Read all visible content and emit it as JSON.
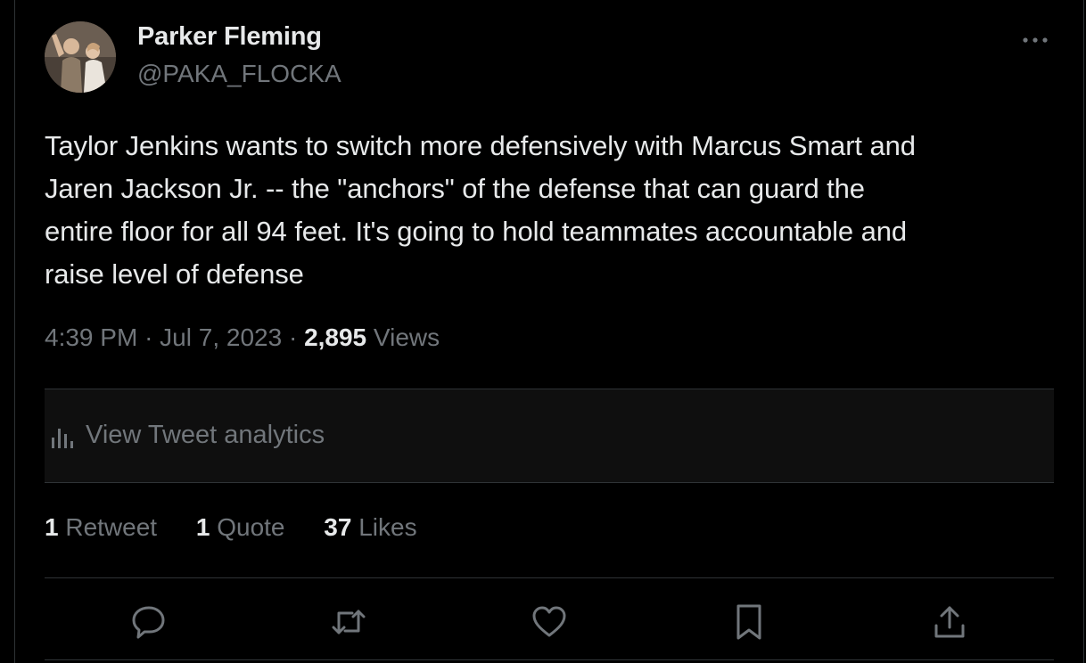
{
  "author": {
    "display_name": "Parker Fleming",
    "handle": "@PAKA_FLOCKA",
    "avatar_icon": "avatar-photo"
  },
  "tweet": {
    "text": "Taylor Jenkins wants to switch more defensively with Marcus Smart and\nJaren Jackson Jr. -- the \"anchors\" of the defense that can guard the\nentire floor for all 94 feet. It's going to hold teammates accountable and\nraise level of defense",
    "time": "4:39 PM",
    "separator": "·",
    "date": "Jul 7, 2023",
    "views_count": "2,895",
    "views_label": "Views"
  },
  "analytics": {
    "label": "View Tweet analytics",
    "icon": "analytics-icon"
  },
  "stats": {
    "retweets_count": "1",
    "retweets_label": "Retweet",
    "quotes_count": "1",
    "quotes_label": "Quote",
    "likes_count": "37",
    "likes_label": "Likes"
  },
  "actions": [
    "reply-icon",
    "retweet-icon",
    "like-icon",
    "bookmark-icon",
    "share-icon"
  ],
  "colors": {
    "background": "#000000",
    "text_primary": "#e7e9ea",
    "text_secondary": "#71767b",
    "border": "#2f3336"
  }
}
